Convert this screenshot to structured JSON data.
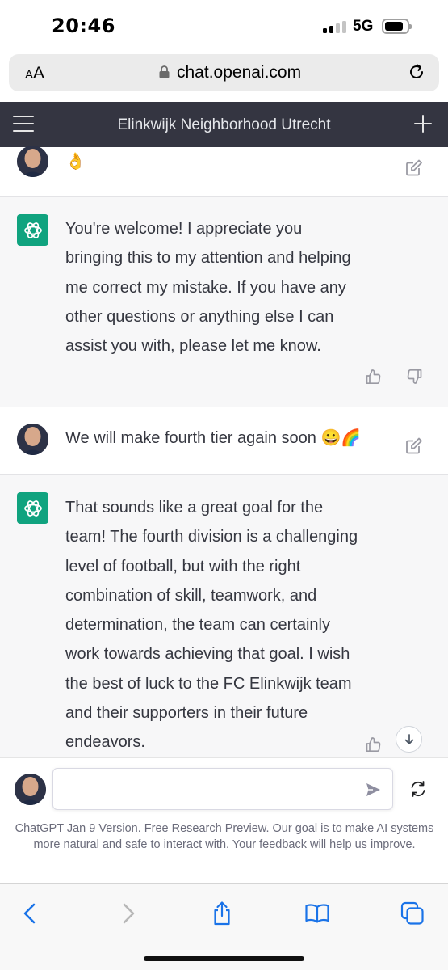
{
  "status_bar": {
    "time": "20:46",
    "network": "5G",
    "battery_level": 0.85
  },
  "browser": {
    "text_size_label": "A",
    "text_size_label_large": "A",
    "url": "chat.openai.com"
  },
  "header": {
    "title": "Elinkwijk Neighborhood Utrecht"
  },
  "messages": [
    {
      "role": "user",
      "text": "👌"
    },
    {
      "role": "assistant",
      "text": "You're welcome! I appreciate you bringing this to my attention and helping me correct my mistake. If you have any other questions or anything else I can assist you with, please let me know."
    },
    {
      "role": "user",
      "text": "We will make fourth tier again soon 😀🌈"
    },
    {
      "role": "assistant",
      "text": "That sounds like a great goal for the team! The fourth division is a challenging level of football, but with the right combination of skill, teamwork, and determination, the team can certainly work towards achieving that goal. I wish the best of luck to the FC Elinkwijk team and their supporters in their future endeavors."
    }
  ],
  "composer": {
    "placeholder": "",
    "version_link": "ChatGPT Jan 9 Version",
    "note": ". Free Research Preview. Our goal is to make AI systems more natural and safe to interact with. Your feedback will help us improve."
  },
  "icons": {
    "menu": "hamburger-icon",
    "new_chat": "plus-icon",
    "edit": "edit-icon",
    "thumbs_up": "thumbs-up-icon",
    "thumbs_down": "thumbs-down-icon",
    "scroll_down": "arrow-down-icon",
    "send": "send-icon",
    "regenerate": "regenerate-icon",
    "back": "chevron-left-icon",
    "forward": "chevron-right-icon",
    "share": "share-icon",
    "bookmarks": "book-icon",
    "tabs": "tabs-icon"
  },
  "colors": {
    "header_bg": "#343541",
    "assistant_bg": "#f7f7f8",
    "openai_green": "#10a37f",
    "safari_blue": "#1a73e8"
  }
}
